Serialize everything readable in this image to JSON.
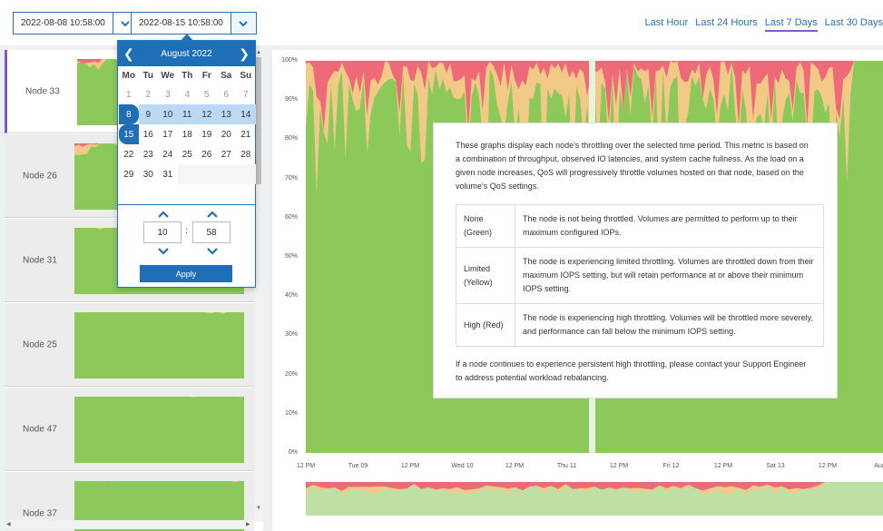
{
  "date_range": {
    "start_value": "2022-08-08 10:58:00",
    "end_value": "2022-08-15 10:58:00"
  },
  "quick_ranges": [
    "Last Hour",
    "Last 24 Hours",
    "Last 7 Days",
    "Last 30 Days"
  ],
  "active_range": "Last 7 Days",
  "nodes": [
    {
      "label": "Node 33",
      "selected": true
    },
    {
      "label": "Node 26",
      "selected": false
    },
    {
      "label": "Node 31",
      "selected": false
    },
    {
      "label": "Node 25",
      "selected": false
    },
    {
      "label": "Node 47",
      "selected": false
    },
    {
      "label": "Node 37",
      "selected": false
    }
  ],
  "calendar": {
    "month_label": "August 2022",
    "weekdays": [
      "Mo",
      "Tu",
      "We",
      "Th",
      "Fr",
      "Sa",
      "Su"
    ],
    "days": [
      [
        "1",
        "2",
        "3",
        "4",
        "5",
        "6",
        "7"
      ],
      [
        "8",
        "9",
        "10",
        "11",
        "12",
        "13",
        "14"
      ],
      [
        "15",
        "16",
        "17",
        "18",
        "19",
        "20",
        "21"
      ],
      [
        "22",
        "23",
        "24",
        "25",
        "26",
        "27",
        "28"
      ],
      [
        "29",
        "30",
        "31",
        "",
        "",
        "",
        ""
      ]
    ],
    "range_start_day": "8",
    "range_end_day": "15",
    "hour": "10",
    "minute": "58",
    "apply_label": "Apply"
  },
  "chart": {
    "y_ticks": [
      "100%",
      "90%",
      "80%",
      "70%",
      "60%",
      "50%",
      "40%",
      "30%",
      "20%",
      "10%",
      "0%"
    ],
    "x_ticks": [
      "12 PM",
      "Tue 09",
      "12 PM",
      "Wed 10",
      "12 PM",
      "Thu 11",
      "12 PM",
      "Fri 12",
      "12 PM",
      "Sat 13",
      "12 PM",
      "Aug"
    ]
  },
  "colors": {
    "none": "#8cc85a",
    "limited": "#f2c986",
    "high": "#ef6a78",
    "accent": "#1f6fb8",
    "selected_border": "#7c5cc4"
  },
  "info": {
    "intro": "These graphs display each node's throttling over the selected time period. This metric is based on a combination of throughput, observed IO latencies, and system cache fullness. As the load on a given node increases, QoS will progressively throttle volumes hosted on that node, based on the volume's QoS settings.",
    "levels": [
      {
        "name": "None (Green)",
        "desc": "The node is not being throttled. Volumes are permitted to perform up to their maximum configured IOPs."
      },
      {
        "name": "Limited (Yellow)",
        "desc": "The node is experiencing limited throttling. Volumes are throttled down from their maximum IOPS setting, but will retain performance at or above their minimum IOPS setting."
      },
      {
        "name": "High (Red)",
        "desc": "The node is experiencing high throttling. Volumes will be throttled more severely, and performance can fall below the minimum IOPS setting."
      }
    ],
    "footer": "If a node continues to experience persistent high throttling, please contact your Support Engineer to address potential workload rebalancing."
  }
}
